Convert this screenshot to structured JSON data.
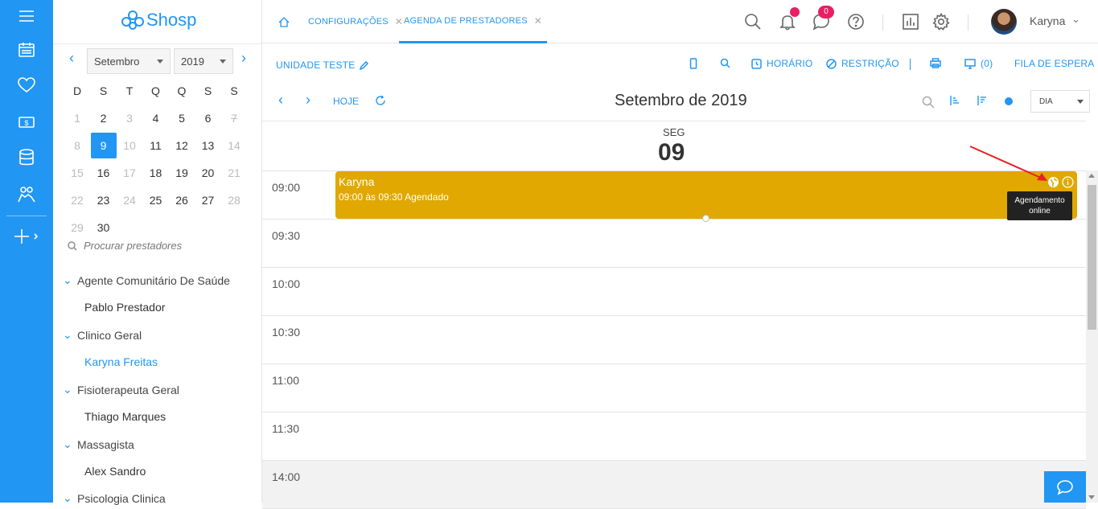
{
  "app": {
    "logo_text": "Shosp"
  },
  "calendar": {
    "month_select": "Setembro",
    "year_select": "2019",
    "weekdays": [
      "D",
      "S",
      "T",
      "Q",
      "Q",
      "S",
      "S"
    ],
    "weeks": [
      [
        "1",
        "2",
        "3",
        "4",
        "5",
        "6",
        "7"
      ],
      [
        "8",
        "9",
        "10",
        "11",
        "12",
        "13",
        "14"
      ],
      [
        "15",
        "16",
        "17",
        "18",
        "19",
        "20",
        "21"
      ],
      [
        "22",
        "23",
        "24",
        "25",
        "26",
        "27",
        "28"
      ],
      [
        "29",
        "30"
      ]
    ],
    "selected_day": "9"
  },
  "sidebar": {
    "search_placeholder": "Procurar prestadores",
    "groups": [
      {
        "label": "Agente Comunitário De Saúde",
        "provider": "Pablo Prestador"
      },
      {
        "label": "Clinico Geral",
        "provider": "Karyna Freitas"
      },
      {
        "label": "Fisioterapeuta Geral",
        "provider": "Thiago Marques"
      },
      {
        "label": "Massagista",
        "provider": "Alex Sandro"
      },
      {
        "label": "Psicologia Clinica",
        "provider": ""
      }
    ]
  },
  "tabs": [
    {
      "label": "CONFIGURAÇÕES"
    },
    {
      "label": "AGENDA DE PRESTADORES"
    }
  ],
  "header": {
    "notification_badge": "",
    "messages_badge": "0",
    "user_name": "Karyna"
  },
  "toolbar": {
    "unit_label": "UNIDADE TESTE",
    "horario_label": "HORÁRIO",
    "restricao_label": "RESTRIÇÃO",
    "queue_count": "(0)",
    "fila_label": "FILA DE ESPERA"
  },
  "nav": {
    "hoje_label": "HOJE",
    "month_title": "Setembro de 2019",
    "view_select": "DIA"
  },
  "day": {
    "weekday": "SEG",
    "number": "09"
  },
  "slots": [
    "09:00",
    "09:30",
    "10:00",
    "10:30",
    "11:00",
    "11:30",
    "14:00"
  ],
  "event": {
    "name": "Karyna",
    "detail": "09:00 às 09:30 Agendado",
    "color": "#e0a800"
  },
  "tooltip": {
    "text_line1": "Agendamento",
    "text_line2": "online"
  },
  "colors": {
    "accent": "#2196f3",
    "badge": "#e91e63"
  }
}
